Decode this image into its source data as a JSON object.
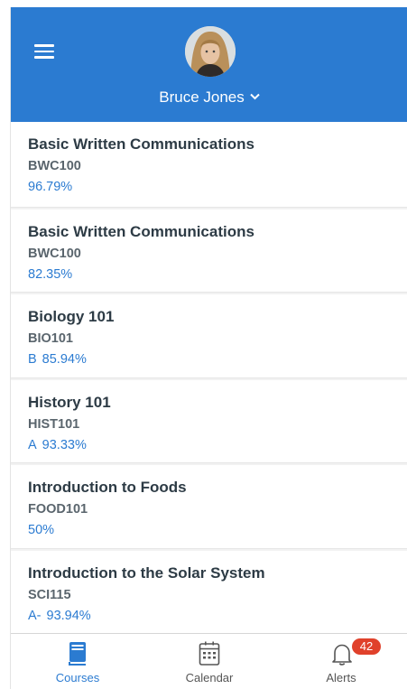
{
  "header": {
    "user_name": "Bruce Jones"
  },
  "courses": [
    {
      "title": "Basic Written Communications",
      "code": "BWC100",
      "letter": "",
      "score": "96.79%"
    },
    {
      "title": "Basic Written Communications",
      "code": "BWC100",
      "letter": "",
      "score": "82.35%"
    },
    {
      "title": "Biology 101",
      "code": "BIO101",
      "letter": "B",
      "score": "85.94%"
    },
    {
      "title": "History 101",
      "code": "HIST101",
      "letter": "A",
      "score": "93.33%"
    },
    {
      "title": "Introduction to Foods",
      "code": "FOOD101",
      "letter": "",
      "score": "50%"
    },
    {
      "title": "Introduction to the Solar System",
      "code": "SCI115",
      "letter": "A-",
      "score": "93.94%"
    }
  ],
  "tabs": {
    "courses": "Courses",
    "calendar": "Calendar",
    "alerts": "Alerts",
    "alerts_badge": "42"
  },
  "colors": {
    "header_bg": "#2b7bd1",
    "accent": "#2b7bd1",
    "badge": "#e0412b"
  },
  "icons": [
    "menu-icon",
    "avatar",
    "chevron-down-icon",
    "courses-book-icon",
    "calendar-icon",
    "bell-icon"
  ]
}
